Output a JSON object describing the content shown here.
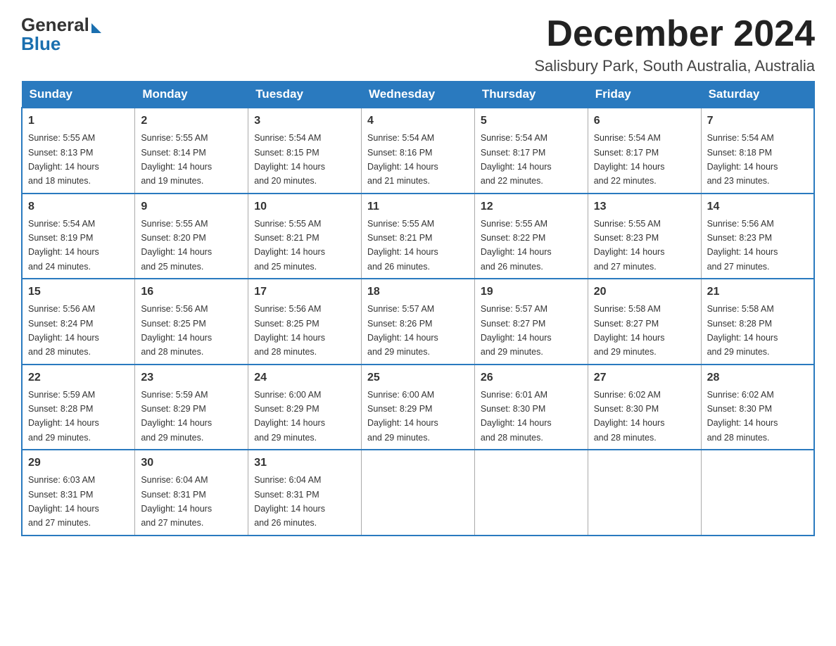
{
  "header": {
    "logo_general": "General",
    "logo_blue": "Blue",
    "month_title": "December 2024",
    "subtitle": "Salisbury Park, South Australia, Australia"
  },
  "days_of_week": [
    "Sunday",
    "Monday",
    "Tuesday",
    "Wednesday",
    "Thursday",
    "Friday",
    "Saturday"
  ],
  "weeks": [
    [
      {
        "day": "1",
        "sunrise": "5:55 AM",
        "sunset": "8:13 PM",
        "daylight": "14 hours and 18 minutes."
      },
      {
        "day": "2",
        "sunrise": "5:55 AM",
        "sunset": "8:14 PM",
        "daylight": "14 hours and 19 minutes."
      },
      {
        "day": "3",
        "sunrise": "5:54 AM",
        "sunset": "8:15 PM",
        "daylight": "14 hours and 20 minutes."
      },
      {
        "day": "4",
        "sunrise": "5:54 AM",
        "sunset": "8:16 PM",
        "daylight": "14 hours and 21 minutes."
      },
      {
        "day": "5",
        "sunrise": "5:54 AM",
        "sunset": "8:17 PM",
        "daylight": "14 hours and 22 minutes."
      },
      {
        "day": "6",
        "sunrise": "5:54 AM",
        "sunset": "8:17 PM",
        "daylight": "14 hours and 22 minutes."
      },
      {
        "day": "7",
        "sunrise": "5:54 AM",
        "sunset": "8:18 PM",
        "daylight": "14 hours and 23 minutes."
      }
    ],
    [
      {
        "day": "8",
        "sunrise": "5:54 AM",
        "sunset": "8:19 PM",
        "daylight": "14 hours and 24 minutes."
      },
      {
        "day": "9",
        "sunrise": "5:55 AM",
        "sunset": "8:20 PM",
        "daylight": "14 hours and 25 minutes."
      },
      {
        "day": "10",
        "sunrise": "5:55 AM",
        "sunset": "8:21 PM",
        "daylight": "14 hours and 25 minutes."
      },
      {
        "day": "11",
        "sunrise": "5:55 AM",
        "sunset": "8:21 PM",
        "daylight": "14 hours and 26 minutes."
      },
      {
        "day": "12",
        "sunrise": "5:55 AM",
        "sunset": "8:22 PM",
        "daylight": "14 hours and 26 minutes."
      },
      {
        "day": "13",
        "sunrise": "5:55 AM",
        "sunset": "8:23 PM",
        "daylight": "14 hours and 27 minutes."
      },
      {
        "day": "14",
        "sunrise": "5:56 AM",
        "sunset": "8:23 PM",
        "daylight": "14 hours and 27 minutes."
      }
    ],
    [
      {
        "day": "15",
        "sunrise": "5:56 AM",
        "sunset": "8:24 PM",
        "daylight": "14 hours and 28 minutes."
      },
      {
        "day": "16",
        "sunrise": "5:56 AM",
        "sunset": "8:25 PM",
        "daylight": "14 hours and 28 minutes."
      },
      {
        "day": "17",
        "sunrise": "5:56 AM",
        "sunset": "8:25 PM",
        "daylight": "14 hours and 28 minutes."
      },
      {
        "day": "18",
        "sunrise": "5:57 AM",
        "sunset": "8:26 PM",
        "daylight": "14 hours and 29 minutes."
      },
      {
        "day": "19",
        "sunrise": "5:57 AM",
        "sunset": "8:27 PM",
        "daylight": "14 hours and 29 minutes."
      },
      {
        "day": "20",
        "sunrise": "5:58 AM",
        "sunset": "8:27 PM",
        "daylight": "14 hours and 29 minutes."
      },
      {
        "day": "21",
        "sunrise": "5:58 AM",
        "sunset": "8:28 PM",
        "daylight": "14 hours and 29 minutes."
      }
    ],
    [
      {
        "day": "22",
        "sunrise": "5:59 AM",
        "sunset": "8:28 PM",
        "daylight": "14 hours and 29 minutes."
      },
      {
        "day": "23",
        "sunrise": "5:59 AM",
        "sunset": "8:29 PM",
        "daylight": "14 hours and 29 minutes."
      },
      {
        "day": "24",
        "sunrise": "6:00 AM",
        "sunset": "8:29 PM",
        "daylight": "14 hours and 29 minutes."
      },
      {
        "day": "25",
        "sunrise": "6:00 AM",
        "sunset": "8:29 PM",
        "daylight": "14 hours and 29 minutes."
      },
      {
        "day": "26",
        "sunrise": "6:01 AM",
        "sunset": "8:30 PM",
        "daylight": "14 hours and 28 minutes."
      },
      {
        "day": "27",
        "sunrise": "6:02 AM",
        "sunset": "8:30 PM",
        "daylight": "14 hours and 28 minutes."
      },
      {
        "day": "28",
        "sunrise": "6:02 AM",
        "sunset": "8:30 PM",
        "daylight": "14 hours and 28 minutes."
      }
    ],
    [
      {
        "day": "29",
        "sunrise": "6:03 AM",
        "sunset": "8:31 PM",
        "daylight": "14 hours and 27 minutes."
      },
      {
        "day": "30",
        "sunrise": "6:04 AM",
        "sunset": "8:31 PM",
        "daylight": "14 hours and 27 minutes."
      },
      {
        "day": "31",
        "sunrise": "6:04 AM",
        "sunset": "8:31 PM",
        "daylight": "14 hours and 26 minutes."
      },
      null,
      null,
      null,
      null
    ]
  ],
  "labels": {
    "sunrise": "Sunrise:",
    "sunset": "Sunset:",
    "daylight": "Daylight:"
  }
}
